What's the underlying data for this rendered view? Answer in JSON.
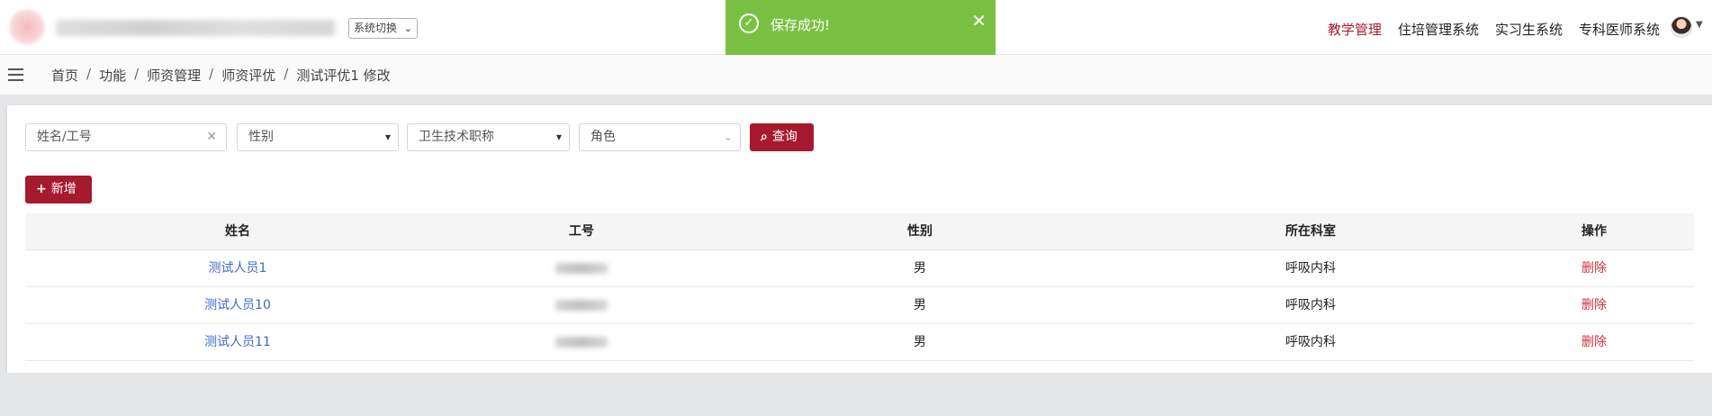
{
  "header": {
    "system_switch_label": "系统切换",
    "nav_items": [
      {
        "label": "教学管理",
        "active": true
      },
      {
        "label": "住培管理系统",
        "active": false
      },
      {
        "label": "实习生系统",
        "active": false
      },
      {
        "label": "专科医师系统",
        "active": false
      }
    ]
  },
  "toast": {
    "message": "保存成功!",
    "close_glyph": "✕"
  },
  "breadcrumb": [
    "首页",
    "功能",
    "师资管理",
    "师资评优",
    "测试评优1 修改"
  ],
  "breadcrumb_separator": "/",
  "filters": {
    "name_placeholder": "姓名/工号",
    "gender_placeholder": "性别",
    "title_placeholder": "卫生技术职称",
    "role_placeholder": "角色",
    "query_label": "查询",
    "add_label": "新增"
  },
  "table": {
    "columns": [
      "姓名",
      "工号",
      "性别",
      "所在科室",
      "操作"
    ],
    "rows": [
      {
        "name": "测试人员1",
        "gender": "男",
        "dept": "呼吸内科",
        "action": "删除"
      },
      {
        "name": "测试人员10",
        "gender": "男",
        "dept": "呼吸内科",
        "action": "删除"
      },
      {
        "name": "测试人员11",
        "gender": "男",
        "dept": "呼吸内科",
        "action": "删除"
      }
    ]
  },
  "colors": {
    "accent": "#a6192e",
    "toast_green": "#7ac143",
    "link_blue": "#3b6cc5",
    "danger_red": "#d0313d"
  },
  "icons": [
    "hospital-logo-icon",
    "check-circle-icon",
    "close-icon",
    "menu-icon",
    "search-icon",
    "plus-icon",
    "chevron-down-icon",
    "avatar-icon"
  ]
}
